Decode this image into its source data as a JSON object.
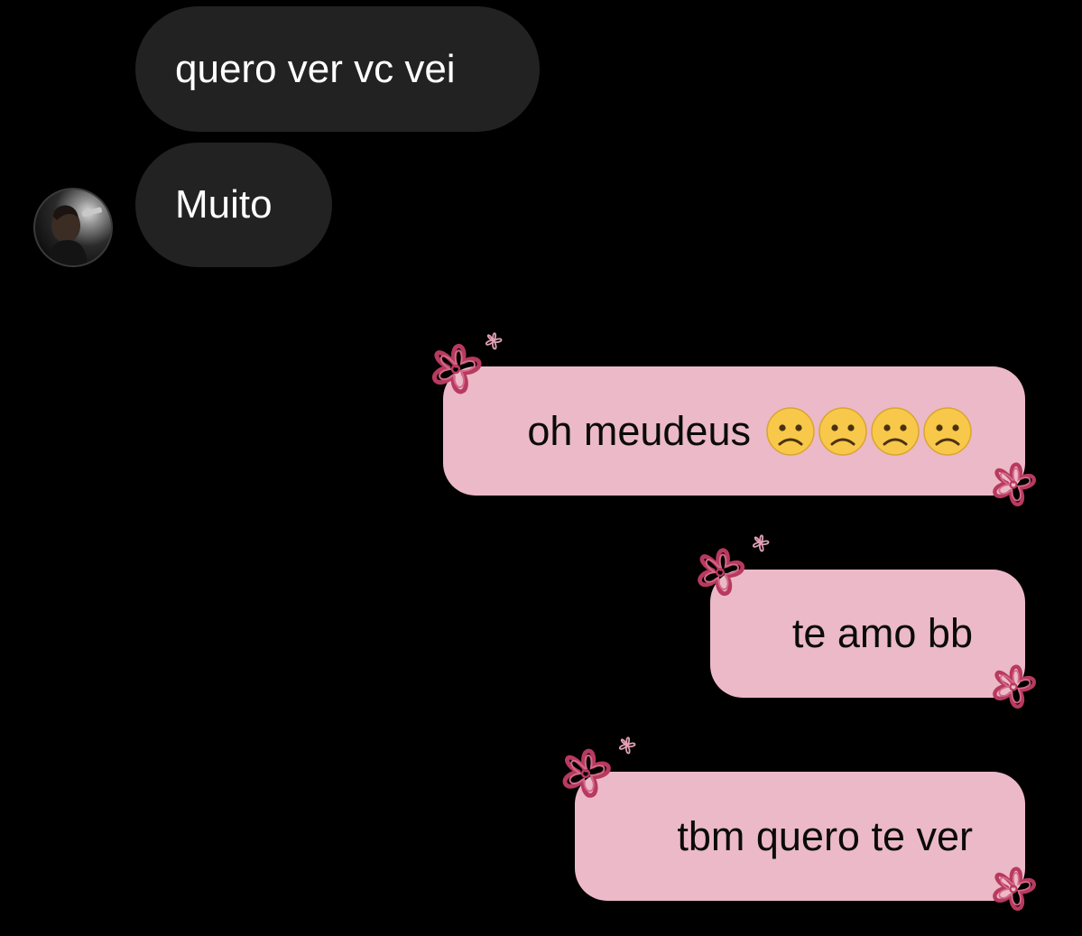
{
  "conversation": {
    "received": [
      {
        "text": "quero ver vc vei"
      },
      {
        "text": "Muito"
      }
    ],
    "sent": [
      {
        "text": "oh meudeus",
        "emoji": [
          "worried-face",
          "worried-face",
          "worried-face",
          "worried-face"
        ]
      },
      {
        "text": "te amo bb"
      },
      {
        "text": "tbm quero te ver"
      }
    ]
  },
  "colors": {
    "background": "#000000",
    "received_bubble": "#222222",
    "received_text": "#ffffff",
    "sent_bubble": "#ecb9c9",
    "sent_text": "#0b0b0b",
    "flower_stroke": "#b83a5e",
    "emoji_face": "#f7c84a"
  },
  "icons": {
    "avatar": "contact-avatar-photo",
    "decoration_large": "flower-doodle-icon",
    "decoration_small": "sparkle-flower-icon"
  }
}
